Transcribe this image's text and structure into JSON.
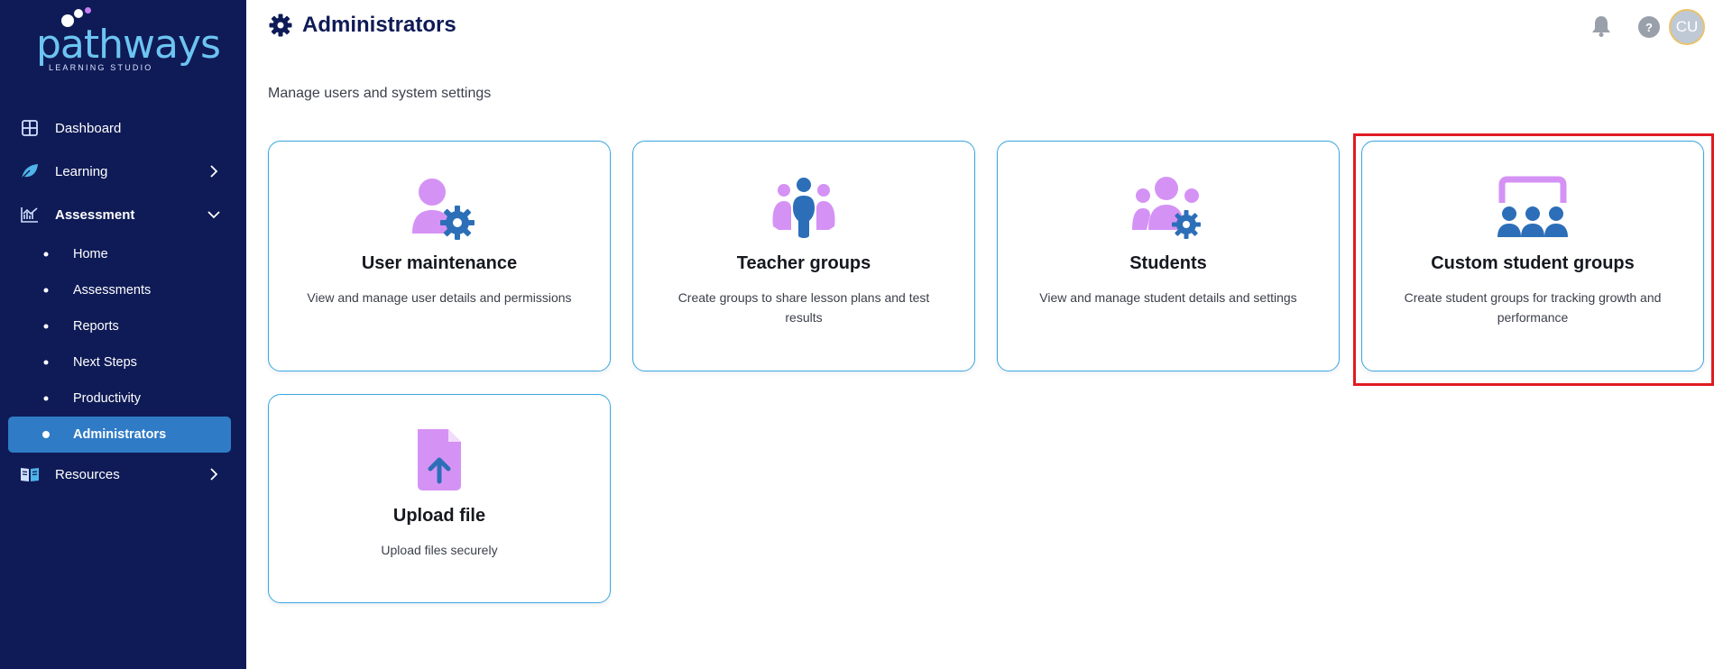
{
  "sidebar": {
    "logo": {
      "word": "pathways",
      "sub": "LEARNING STUDIO"
    },
    "items": [
      {
        "label": "Dashboard"
      },
      {
        "label": "Learning"
      },
      {
        "label": "Assessment"
      },
      {
        "label": "Resources"
      }
    ],
    "assessment_sub": [
      {
        "label": "Home"
      },
      {
        "label": "Assessments"
      },
      {
        "label": "Reports"
      },
      {
        "label": "Next Steps"
      },
      {
        "label": "Productivity"
      },
      {
        "label": "Administrators"
      }
    ]
  },
  "header": {
    "title": "Administrators",
    "subtitle": "Manage users and system settings",
    "help_label": "?",
    "avatar_initials": "CU"
  },
  "cards": [
    {
      "title": "User maintenance",
      "desc": "View and manage user details and permissions"
    },
    {
      "title": "Teacher groups",
      "desc": "Create groups to share lesson plans and test results"
    },
    {
      "title": "Students",
      "desc": "View and manage student details and settings"
    },
    {
      "title": "Custom student groups",
      "desc": "Create student groups for tracking growth and performance"
    },
    {
      "title": "Upload file",
      "desc": "Upload files securely"
    }
  ],
  "colors": {
    "sidebar_bg": "#0f1b56",
    "active_item": "#2f7bc6",
    "card_border": "#3aa6e0",
    "icon_purple": "#d592f5",
    "icon_blue": "#2c6fb8",
    "highlight": "#e01b22"
  }
}
